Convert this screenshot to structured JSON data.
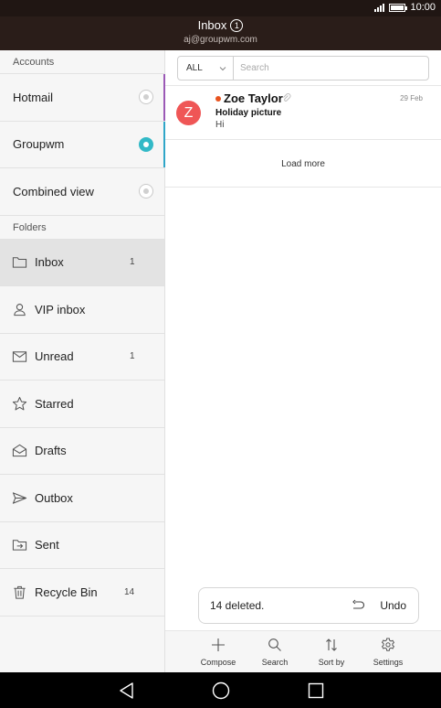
{
  "status_bar": {
    "time": "10:00"
  },
  "header": {
    "title": "Inbox",
    "unread_count": "1",
    "account_email": "aj@groupwm.com"
  },
  "sidebar": {
    "accounts_heading": "Accounts",
    "accounts": [
      {
        "label": "Hotmail",
        "selected": false
      },
      {
        "label": "Groupwm",
        "selected": true
      },
      {
        "label": "Combined view",
        "selected": false
      }
    ],
    "folders_heading": "Folders",
    "folders": [
      {
        "label": "Inbox",
        "count": "1",
        "icon": "folder-icon",
        "active": true
      },
      {
        "label": "VIP inbox",
        "count": "",
        "icon": "person-icon"
      },
      {
        "label": "Unread",
        "count": "1",
        "icon": "envelope-icon"
      },
      {
        "label": "Starred",
        "count": "",
        "icon": "star-icon"
      },
      {
        "label": "Drafts",
        "count": "",
        "icon": "drafts-icon"
      },
      {
        "label": "Outbox",
        "count": "",
        "icon": "send-icon"
      },
      {
        "label": "Sent",
        "count": "",
        "icon": "sent-icon"
      },
      {
        "label": "Recycle Bin",
        "count": "14",
        "icon": "trash-icon"
      }
    ]
  },
  "main": {
    "filter": {
      "value": "ALL"
    },
    "search": {
      "placeholder": "Search"
    },
    "messages": [
      {
        "avatar_letter": "Z",
        "sender": "Zoe Taylor",
        "date": "29 Feb",
        "subject": "Holiday picture",
        "preview": "Hi"
      }
    ],
    "load_more": "Load more",
    "toast": {
      "text": "14 deleted.",
      "action": "Undo"
    },
    "toolbar": {
      "compose": "Compose",
      "search": "Search",
      "sort": "Sort by",
      "settings": "Settings"
    }
  },
  "colors": {
    "header_bg": "#2a1d19",
    "accent_teal": "#32b9c7",
    "avatar_red": "#ef5656",
    "unread_dot": "#e8531f"
  }
}
